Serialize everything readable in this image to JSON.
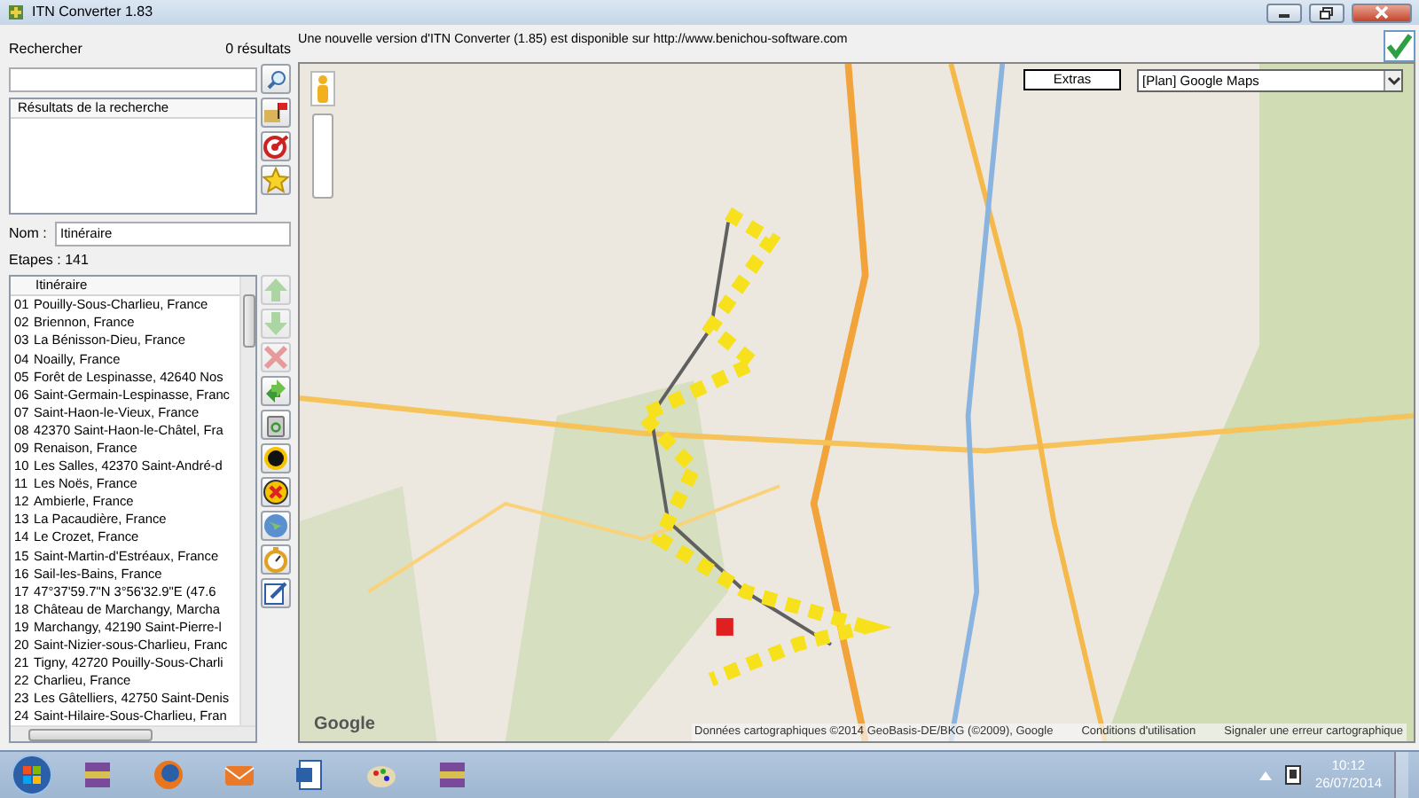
{
  "window": {
    "title": "ITN Converter 1.83"
  },
  "update_notice": "Une nouvelle version d'ITN Converter (1.85) est disponible sur http://www.benichou-software.com",
  "search": {
    "label": "Rechercher",
    "count": "0 résultats"
  },
  "search_results": {
    "header": "Résultats de la recherche"
  },
  "search_tools": [
    {
      "kind": "export"
    },
    {
      "kind": "target"
    },
    {
      "kind": "favorite"
    }
  ],
  "name": {
    "label": "Nom :",
    "value": "Itinéraire"
  },
  "steps": "Etapes : 141",
  "itinerary": {
    "header": "Itinéraire",
    "rows": [
      {
        "number": "01",
        "place": "Pouilly-Sous-Charlieu, France"
      },
      {
        "number": "02",
        "place": "Briennon, France"
      },
      {
        "number": "03",
        "place": "La Bénisson-Dieu, France"
      },
      {
        "number": "04",
        "place": "Noailly, France"
      },
      {
        "number": "05",
        "place": "Forêt de Lespinasse, 42640 Nos"
      },
      {
        "number": "06",
        "place": "Saint-Germain-Lespinasse, Franc"
      },
      {
        "number": "07",
        "place": "Saint-Haon-le-Vieux, France"
      },
      {
        "number": "08",
        "place": "42370 Saint-Haon-le-Châtel, Fra"
      },
      {
        "number": "09",
        "place": "Renaison, France"
      },
      {
        "number": "10",
        "place": "Les Salles, 42370 Saint-André-d"
      },
      {
        "number": "11",
        "place": "Les Noës, France"
      },
      {
        "number": "12",
        "place": "Ambierle, France"
      },
      {
        "number": "13",
        "place": "La Pacaudière, France"
      },
      {
        "number": "14",
        "place": "Le Crozet, France"
      },
      {
        "number": "15",
        "place": "Saint-Martin-d'Estréaux, France"
      },
      {
        "number": "16",
        "place": "Sail-les-Bains, France"
      },
      {
        "number": "17",
        "place": "47°37'59.7\"N 3°56'32.9\"E (47.6"
      },
      {
        "number": "18",
        "place": "Château de Marchangy, Marcha"
      },
      {
        "number": "19",
        "place": "Marchangy, 42190 Saint-Pierre-l"
      },
      {
        "number": "20",
        "place": "Saint-Nizier-sous-Charlieu, Franc"
      },
      {
        "number": "21",
        "place": "Tigny, 42720 Pouilly-Sous-Charli"
      },
      {
        "number": "22",
        "place": "Charlieu, France"
      },
      {
        "number": "23",
        "place": "Les Gâtelliers, 42750 Saint-Denis"
      },
      {
        "number": "24",
        "place": "Saint-Hilaire-Sous-Charlieu, Fran"
      }
    ]
  },
  "itinerary_tools": [
    {
      "kind": "move-up",
      "disabled": true
    },
    {
      "kind": "move-down",
      "disabled": true
    },
    {
      "kind": "delete",
      "disabled": true
    },
    {
      "kind": "reverse",
      "disabled": false
    },
    {
      "kind": "trash",
      "disabled": false
    },
    {
      "kind": "ring",
      "disabled": false
    },
    {
      "kind": "cancel",
      "disabled": false
    },
    {
      "kind": "globe",
      "disabled": false
    },
    {
      "kind": "timer",
      "disabled": false
    },
    {
      "kind": "edit",
      "disabled": false
    }
  ],
  "map": {
    "extras_button": "Extras",
    "map_type": "[Plan] Google Maps",
    "logo": "Google",
    "attribution": "Données cartographiques ©2014 GeoBasis-DE/BKG (©2009), Google",
    "terms": "Conditions d'utilisation",
    "report": "Signaler une erreur cartographique"
  },
  "taskbar": {
    "apps": [
      {
        "kind": "archive"
      },
      {
        "kind": "browser"
      },
      {
        "kind": "mail"
      },
      {
        "kind": "word"
      },
      {
        "kind": "paint"
      },
      {
        "kind": "archive"
      }
    ],
    "time": "10:12",
    "date": "26/07/2014"
  }
}
